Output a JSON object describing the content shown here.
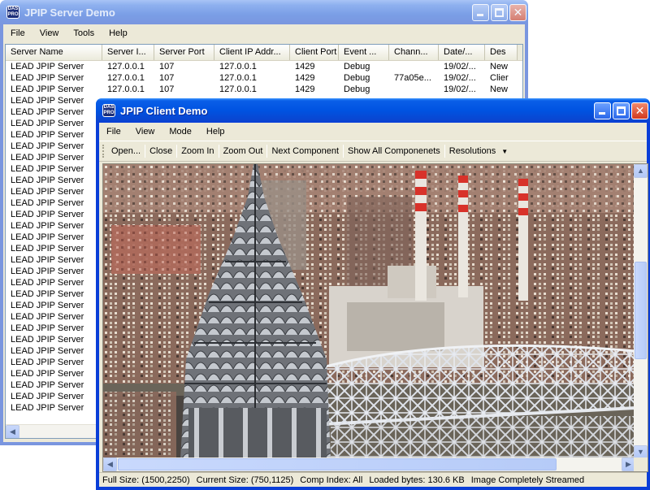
{
  "server": {
    "title": "JPIP Server Demo",
    "menu": [
      "File",
      "View",
      "Tools",
      "Help"
    ],
    "columns": [
      "Server Name",
      "Server I...",
      "Server Port",
      "Client IP Addr...",
      "Client Port",
      "Event ...",
      "Chann...",
      "Date/...",
      "Des"
    ],
    "rows": [
      [
        "LEAD JPIP Server",
        "127.0.0.1",
        "107",
        "127.0.0.1",
        "1429",
        "Debug",
        "",
        "19/02/...",
        "New"
      ],
      [
        "LEAD JPIP Server",
        "127.0.0.1",
        "107",
        "127.0.0.1",
        "1429",
        "Debug",
        "77a05e...",
        "19/02/...",
        "Clier"
      ],
      [
        "LEAD JPIP Server",
        "127.0.0.1",
        "107",
        "127.0.0.1",
        "1429",
        "Debug",
        "",
        "19/02/...",
        "New"
      ],
      [
        "LEAD JPIP Server"
      ],
      [
        "LEAD JPIP Server"
      ],
      [
        "LEAD JPIP Server"
      ],
      [
        "LEAD JPIP Server"
      ],
      [
        "LEAD JPIP Server"
      ],
      [
        "LEAD JPIP Server"
      ],
      [
        "LEAD JPIP Server"
      ],
      [
        "LEAD JPIP Server"
      ],
      [
        "LEAD JPIP Server"
      ],
      [
        "LEAD JPIP Server"
      ],
      [
        "LEAD JPIP Server"
      ],
      [
        "LEAD JPIP Server"
      ],
      [
        "LEAD JPIP Server"
      ],
      [
        "LEAD JPIP Server"
      ],
      [
        "LEAD JPIP Server"
      ],
      [
        "LEAD JPIP Server"
      ],
      [
        "LEAD JPIP Server"
      ],
      [
        "LEAD JPIP Server"
      ],
      [
        "LEAD JPIP Server"
      ],
      [
        "LEAD JPIP Server"
      ],
      [
        "LEAD JPIP Server"
      ],
      [
        "LEAD JPIP Server"
      ],
      [
        "LEAD JPIP Server"
      ],
      [
        "LEAD JPIP Server"
      ],
      [
        "LEAD JPIP Server"
      ],
      [
        "LEAD JPIP Server"
      ],
      [
        "LEAD JPIP Server"
      ],
      [
        "LEAD JPIP Server"
      ]
    ]
  },
  "client": {
    "title": "JPIP Client Demo",
    "menu": [
      "File",
      "View",
      "Mode",
      "Help"
    ],
    "toolbar": [
      "Open...",
      "Close",
      "Zoom In",
      "Zoom Out",
      "Next Component",
      "Show All Componenets",
      "Resolutions"
    ],
    "status": {
      "full_size": "Full Size: (1500,2250)",
      "current_size": "Current Size: (750,1125)",
      "comp_index": "Comp Index: All",
      "loaded": "Loaded bytes: 130.6 KB",
      "state": "Image Completely Streamed"
    }
  },
  "icons": {
    "app": "LEADTOOLS-app-icon",
    "dropdown": "chevron-down-icon"
  },
  "colors": {
    "title_active": "#0053e1",
    "title_inactive": "#7a96df",
    "chimney_red": "#d8322a"
  }
}
